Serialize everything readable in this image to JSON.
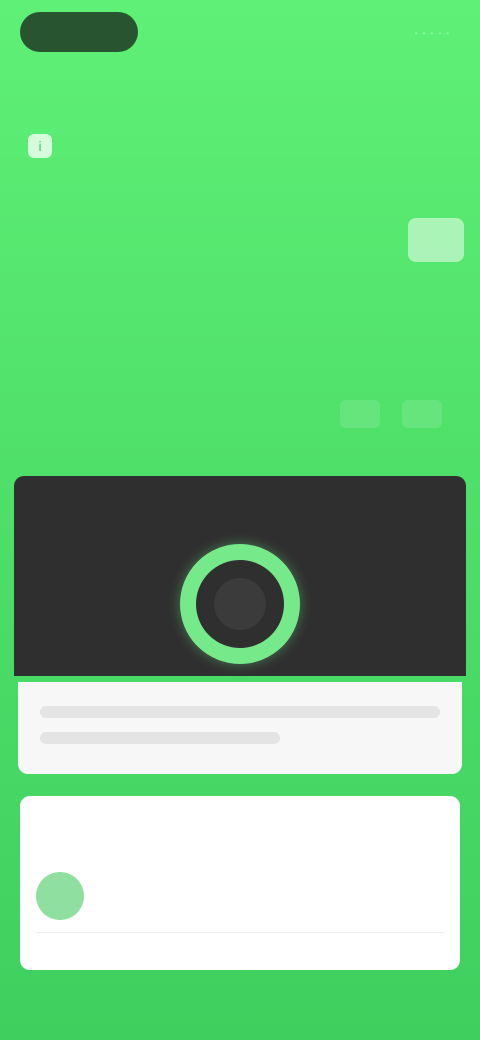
{
  "header": {
    "right_text": "· · · · ·",
    "title": "",
    "subtitle": "",
    "subtitle_icon": "info-icon"
  },
  "hero": {
    "badge_text": ""
  },
  "section": {
    "label": "",
    "actions": [
      "",
      ""
    ]
  },
  "activity_card": {
    "title": "",
    "left_stat": "",
    "right_stat": "",
    "ring_center": "",
    "ring_color": "#76e98b",
    "note": ""
  },
  "bottom_card": {
    "title": "",
    "link": "",
    "row_left": "",
    "row_right": "",
    "footer": ""
  },
  "colors": {
    "accent": "#4fe06a",
    "card_dark": "#2f2f2f",
    "card_light": "#ffffff"
  }
}
